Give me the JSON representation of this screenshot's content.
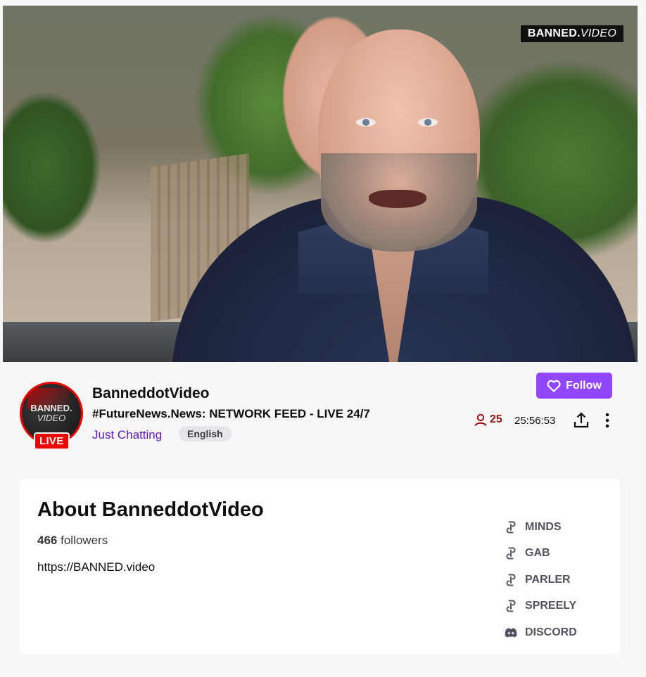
{
  "player": {
    "watermark_brand": "BANNED.",
    "watermark_suffix": "VIDEO"
  },
  "channel": {
    "name": "BanneddotVideo",
    "avatar_text_top": "BANNED.",
    "avatar_text_bottom": "VIDEO",
    "live_label": "LIVE",
    "stream_title": "#FutureNews.News: NETWORK FEED - LIVE 24/7",
    "category": "Just Chatting",
    "language_tag": "English",
    "follow_label": "Follow",
    "viewer_count": "25",
    "uptime": "25:56:53"
  },
  "about": {
    "title": "About BanneddotVideo",
    "followers_count": "466",
    "followers_label": "followers",
    "website": "https://BANNED.video",
    "links": [
      {
        "label": "MINDS",
        "icon": "link-icon"
      },
      {
        "label": "GAB",
        "icon": "link-icon"
      },
      {
        "label": "PARLER",
        "icon": "link-icon"
      },
      {
        "label": "SPREELY",
        "icon": "link-icon"
      },
      {
        "label": "DISCORD",
        "icon": "discord-icon"
      }
    ]
  },
  "colors": {
    "accent": "#9147ff",
    "live": "#eb0400",
    "category": "#5c16c5",
    "viewer": "#971311"
  }
}
